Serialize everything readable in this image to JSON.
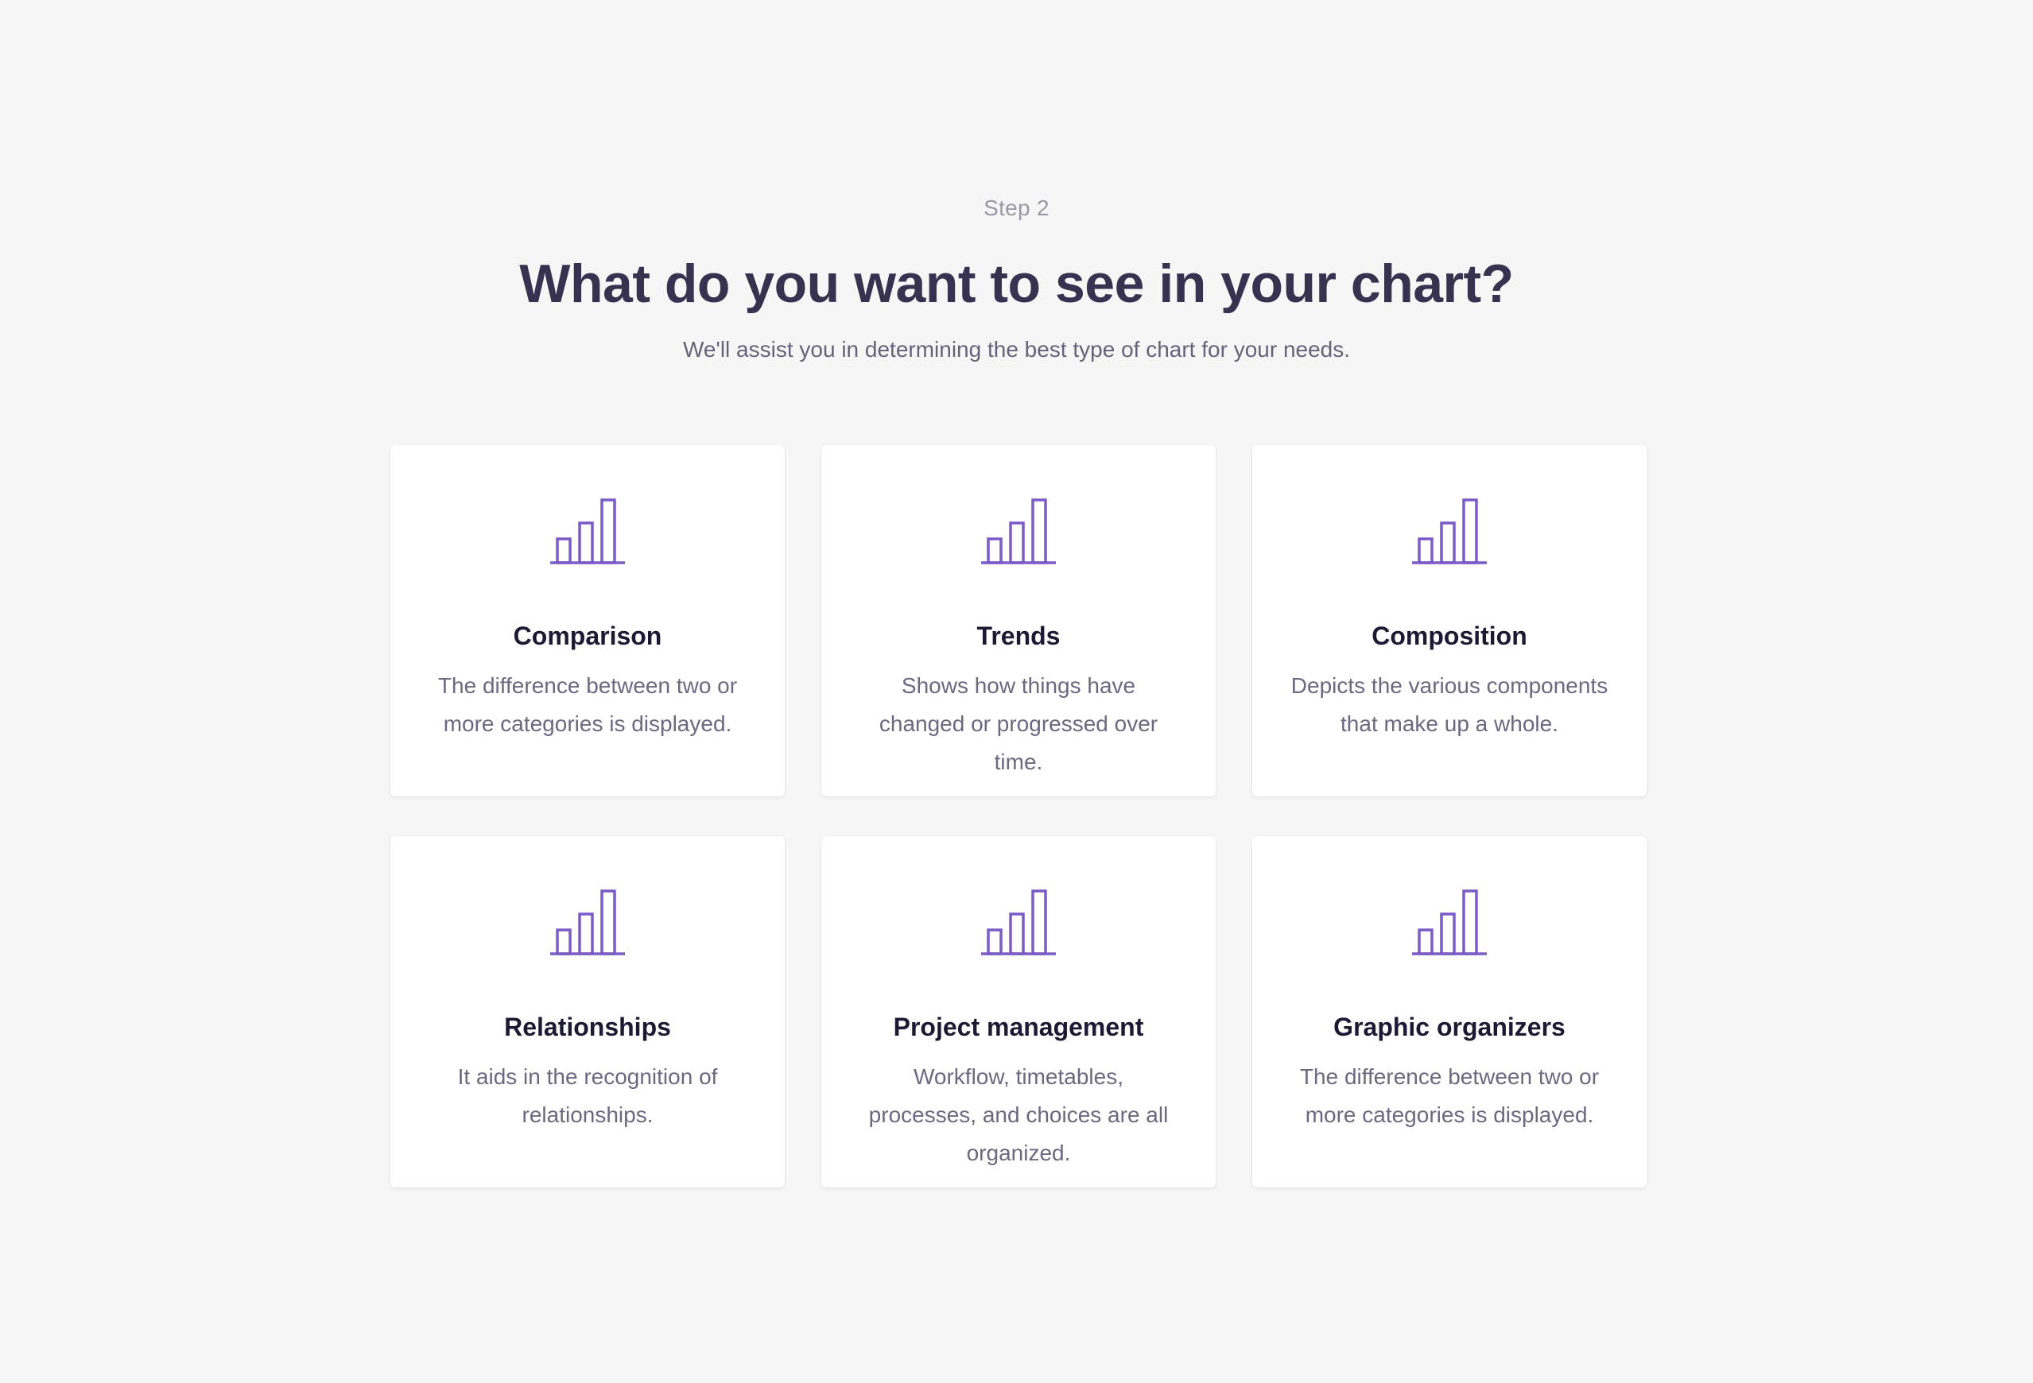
{
  "header": {
    "step": "Step 2",
    "title": "What do you want to see in your chart?",
    "subtitle": "We'll assist you in determining the best type of chart for your needs."
  },
  "colors": {
    "background": "#f6f6f6",
    "card": "#ffffff",
    "accent": "#7a5bc8",
    "title": "#363250",
    "text_muted": "#6b6980"
  },
  "cards": [
    {
      "icon": "bar-chart-icon",
      "title": "Comparison",
      "description": "The difference between two or more categories is displayed."
    },
    {
      "icon": "bar-chart-icon",
      "title": "Trends",
      "description": "Shows how things have changed or progressed over time."
    },
    {
      "icon": "bar-chart-icon",
      "title": "Composition",
      "description": "Depicts the various components that make up a whole."
    },
    {
      "icon": "bar-chart-icon",
      "title": "Relationships",
      "description": "It aids in the recognition of relationships."
    },
    {
      "icon": "bar-chart-icon",
      "title": "Project management",
      "description": "Workflow, timetables, processes, and choices are all organized."
    },
    {
      "icon": "bar-chart-icon",
      "title": "Graphic organizers",
      "description": "The difference between two or more categories is displayed."
    }
  ]
}
